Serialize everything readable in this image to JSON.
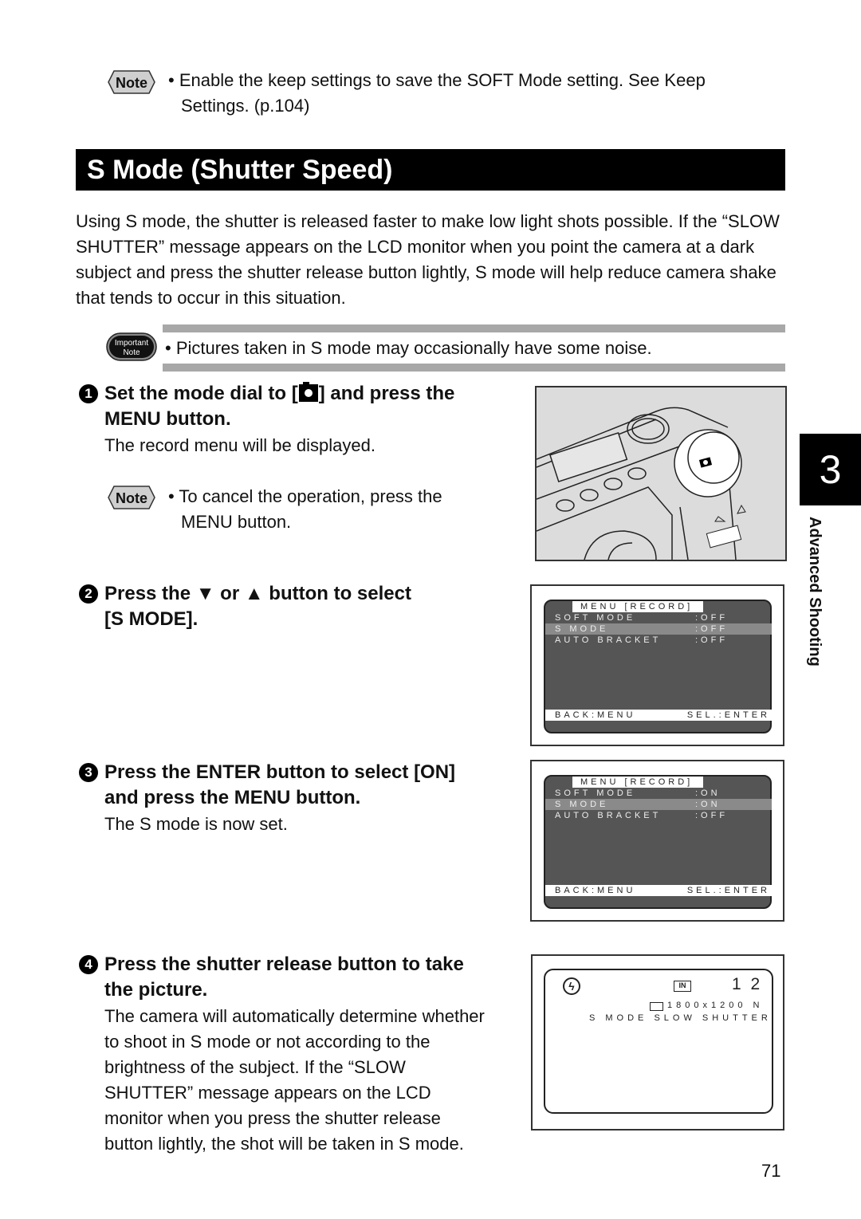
{
  "top_note": {
    "badge": "Note",
    "text_line1": "• Enable the keep settings to save the SOFT Mode setting.  See Keep",
    "text_line2": "Settings. (p.104)"
  },
  "section_title": "S Mode (Shutter Speed)",
  "intro_text": "Using S mode, the shutter is released faster to make low light shots possible.  If the “SLOW SHUTTER” message appears on the LCD monitor when you point the camera at a dark subject and press the shutter release button lightly, S mode will help reduce camera shake that tends to occur in this situation.",
  "important_note": {
    "badge_line1": "Important",
    "badge_line2": "Note",
    "text": "•  Pictures taken in S mode may occasionally have some noise."
  },
  "steps": [
    {
      "number": "1",
      "heading_part1": "Set the mode dial to [",
      "heading_icon": "camera-icon",
      "heading_part2": "] and press the",
      "heading_line2": "MENU button.",
      "body": "The record menu will be displayed.",
      "note": {
        "badge": "Note",
        "line1": "• To cancel the operation, press the",
        "line2": "MENU button."
      }
    },
    {
      "number": "2",
      "heading_part1": "Press the ",
      "down_glyph": "▼",
      "heading_mid": " or ",
      "up_glyph": "▲",
      "heading_part2": "  button to select",
      "heading_line2": "[S MODE]."
    },
    {
      "number": "3",
      "heading_line1": "Press the ENTER button to select [ON]",
      "heading_line2": "and press the MENU button.",
      "body": "The S mode is now set."
    },
    {
      "number": "4",
      "heading_line1": "Press the shutter release button to take",
      "heading_line2": "the picture.",
      "body_lines": [
        "The camera will automatically determine whether",
        "to shoot in S mode or not according to the",
        "brightness of the subject.  If the “SLOW",
        "SHUTTER” message appears on the LCD",
        "monitor when you press the shutter release",
        "button lightly, the shot will be taken in S mode."
      ]
    }
  ],
  "lcd_menu_1": {
    "header": "MENU [RECORD]",
    "rows": [
      {
        "label": "SOFT MODE",
        "value": ":OFF"
      },
      {
        "label": "S MODE",
        "value": ":OFF"
      },
      {
        "label": "AUTO BRACKET",
        "value": ":OFF"
      }
    ],
    "footer_left": "BACK:MENU",
    "footer_right": "SEL.:ENTER"
  },
  "lcd_menu_2": {
    "header": "MENU [RECORD]",
    "rows": [
      {
        "label": "SOFT MODE",
        "value": ":ON"
      },
      {
        "label": "S MODE",
        "value": ":ON"
      },
      {
        "label": "AUTO BRACKET",
        "value": ":OFF"
      }
    ],
    "footer_left": "BACK:MENU",
    "footer_right": "SEL.:ENTER"
  },
  "lcd_shoot": {
    "memory": "IN",
    "count": "1 2",
    "resolution": "1800x1200 N",
    "message": "S MODE SLOW SHUTTER"
  },
  "chapter": {
    "number": "3",
    "label": "Advanced Shooting"
  },
  "page_number": "71"
}
